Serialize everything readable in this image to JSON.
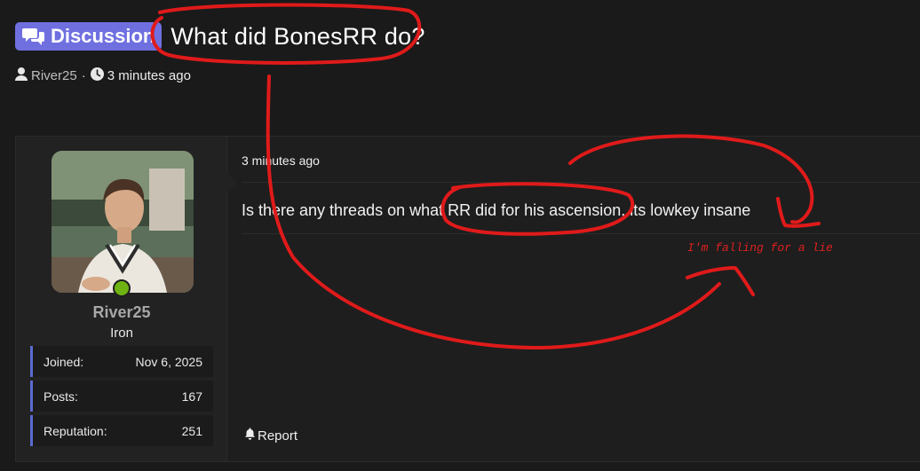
{
  "header": {
    "prefix_label": "Discussion",
    "title": "What did BonesRR do?",
    "author": "River25",
    "separator": "·",
    "time": "3 minutes ago"
  },
  "post": {
    "user": {
      "username": "River25",
      "usertitle": "Iron",
      "online": true,
      "stats": [
        {
          "label": "Joined:",
          "value": "Nov 6, 2025"
        },
        {
          "label": "Posts:",
          "value": "167"
        },
        {
          "label": "Reputation:",
          "value": "251"
        }
      ]
    },
    "time": "3 minutes ago",
    "body": "Is there any threads on what RR did for his ascension, its lowkey insane",
    "report_label": "Report"
  },
  "annotation": {
    "text": "I'm falling for a lie",
    "color": "#e02020"
  },
  "colors": {
    "background": "#1a1a1a",
    "prefix_badge": "#6f6fe0",
    "online": "#6fb313",
    "stat_accent": "#5a6ad0"
  },
  "icons": {
    "prefix": "comments-icon",
    "author": "user-icon",
    "time": "clock-icon",
    "report": "bell-icon"
  }
}
